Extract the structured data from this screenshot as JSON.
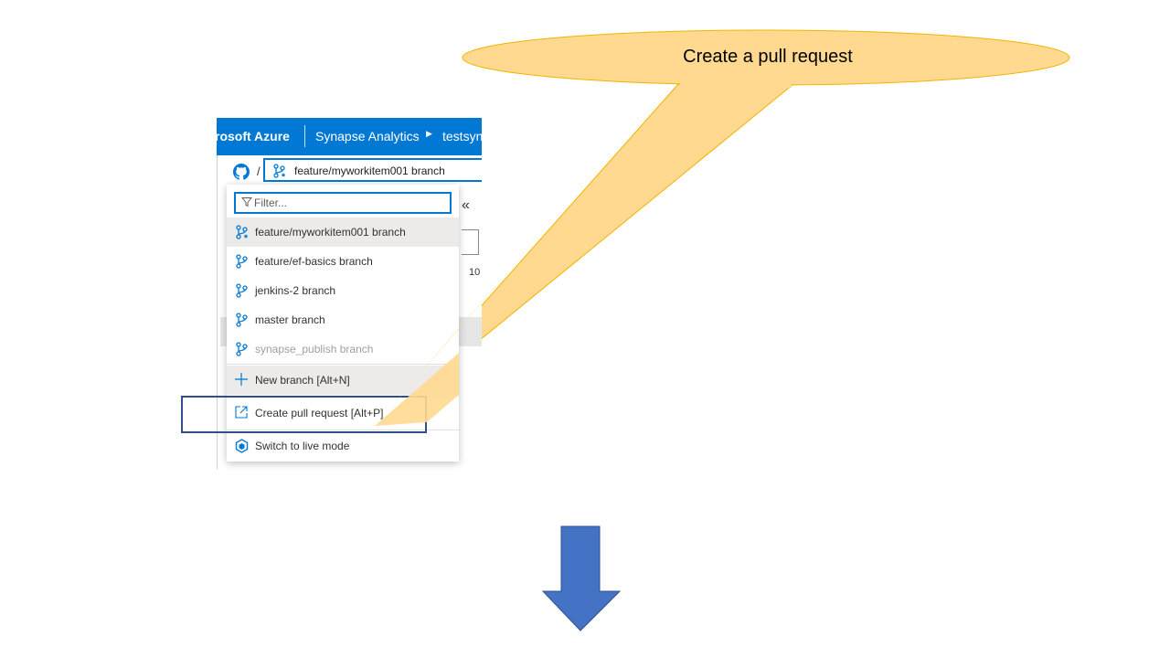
{
  "callout": {
    "text": "Create a pull request"
  },
  "header": {
    "brand": "rosoft Azure",
    "crumb1": "Synapse Analytics",
    "crumb2": "testsyn"
  },
  "git": {
    "slash": "/",
    "current_branch": "feature/myworkitem001 branch"
  },
  "background": {
    "collapse": "«",
    "number": "10"
  },
  "dropdown": {
    "filter_placeholder": "Filter...",
    "branches": [
      {
        "label": "feature/myworkitem001 branch",
        "icon": "branch-star-icon",
        "selected": true
      },
      {
        "label": "feature/ef-basics branch",
        "icon": "branch-icon"
      },
      {
        "label": "jenkins-2 branch",
        "icon": "branch-icon"
      },
      {
        "label": "master branch",
        "icon": "branch-icon"
      },
      {
        "label": "synapse_publish branch",
        "icon": "branch-icon",
        "disabled": true
      }
    ],
    "new_branch": "New branch [Alt+N]",
    "create_pr": "Create pull request [Alt+P]",
    "live_mode": "Switch to live mode"
  },
  "colors": {
    "azure_blue": "#0078d4",
    "callout_fill": "#ffd98f",
    "arrow_fill": "#4472c4",
    "highlight_border": "#2f4f8a"
  }
}
